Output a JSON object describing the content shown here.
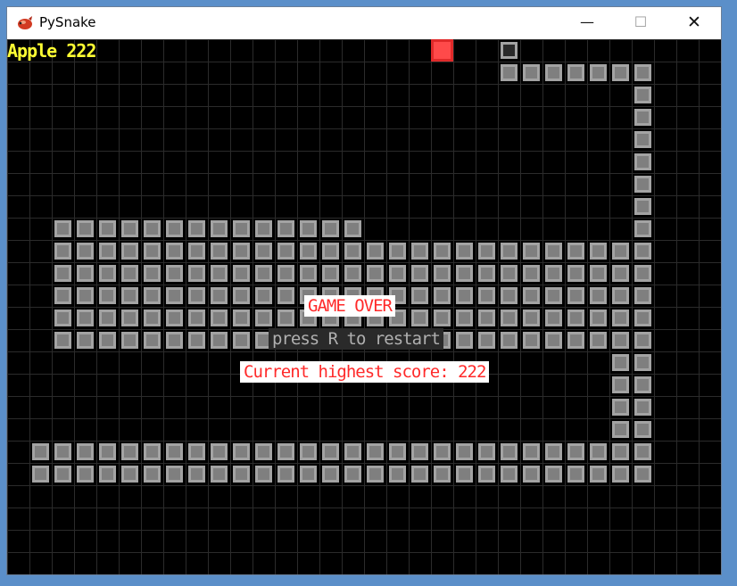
{
  "window": {
    "title": "PySnake",
    "controls": {
      "minimize": "—",
      "maximize": "☐",
      "close": "✕"
    }
  },
  "hud": {
    "score_text": "Apple 222"
  },
  "overlay": {
    "game_over": "GAME OVER",
    "restart_hint": "press R to restart",
    "highest_score": "Current highest score: 222"
  },
  "colors": {
    "apple": "#ff4a4a",
    "snake_fill": "#7f7f7f",
    "snake_border": "#a3a3a3",
    "score_text": "#ffff33",
    "game_over_text": "#ff2a2a"
  },
  "board": {
    "cols": 32,
    "rows": 24,
    "apple": [
      19,
      0
    ],
    "head": [
      22,
      0
    ],
    "snake_rows": [
      [
        1,
        22,
        28
      ],
      [
        2,
        28,
        28
      ],
      [
        3,
        28,
        28
      ],
      [
        4,
        28,
        28
      ],
      [
        5,
        28,
        28
      ],
      [
        6,
        28,
        28
      ],
      [
        7,
        28,
        28
      ],
      [
        8,
        2,
        15
      ],
      [
        8,
        28,
        28
      ],
      [
        9,
        2,
        28
      ],
      [
        10,
        2,
        28
      ],
      [
        11,
        2,
        28
      ],
      [
        12,
        2,
        28
      ],
      [
        13,
        2,
        28
      ],
      [
        14,
        27,
        28
      ],
      [
        15,
        27,
        28
      ],
      [
        16,
        27,
        28
      ],
      [
        17,
        27,
        28
      ],
      [
        18,
        1,
        28
      ],
      [
        19,
        1,
        28
      ]
    ]
  }
}
